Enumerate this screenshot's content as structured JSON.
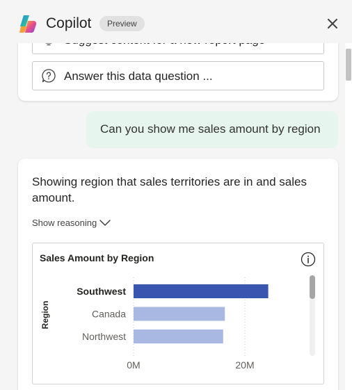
{
  "header": {
    "title": "Copilot",
    "badge": "Preview",
    "close_icon": "close-icon",
    "logo_icon": "copilot-logo-icon"
  },
  "suggestions": [
    {
      "icon": "lightbulb-icon",
      "label": "Suggest content for a new report page"
    },
    {
      "icon": "question-circle-icon",
      "label": "Answer this data question ..."
    }
  ],
  "user_message": "Can you show me sales amount by region",
  "response": {
    "text": "Showing region that sales territories are in and sales amount.",
    "show_reasoning": "Show reasoning"
  },
  "colors": {
    "accent_bar": "#3a55b0",
    "muted_bar": "#a9b7e3",
    "user_bubble": "#e6f5ed"
  },
  "chart": {
    "info_icon": "info-icon"
  },
  "chart_data": {
    "type": "bar",
    "orientation": "horizontal",
    "title": "Sales Amount by Region",
    "ylabel": "Region",
    "xlabel": "",
    "categories": [
      "Southwest",
      "Canada",
      "Northwest"
    ],
    "values": [
      24.2,
      16.4,
      16.1
    ],
    "unit": "M",
    "highlighted": "Southwest",
    "xlim": [
      0,
      30
    ],
    "x_ticks": [
      0,
      20
    ],
    "x_tick_labels": [
      "0M",
      "20M"
    ],
    "grid": true
  }
}
